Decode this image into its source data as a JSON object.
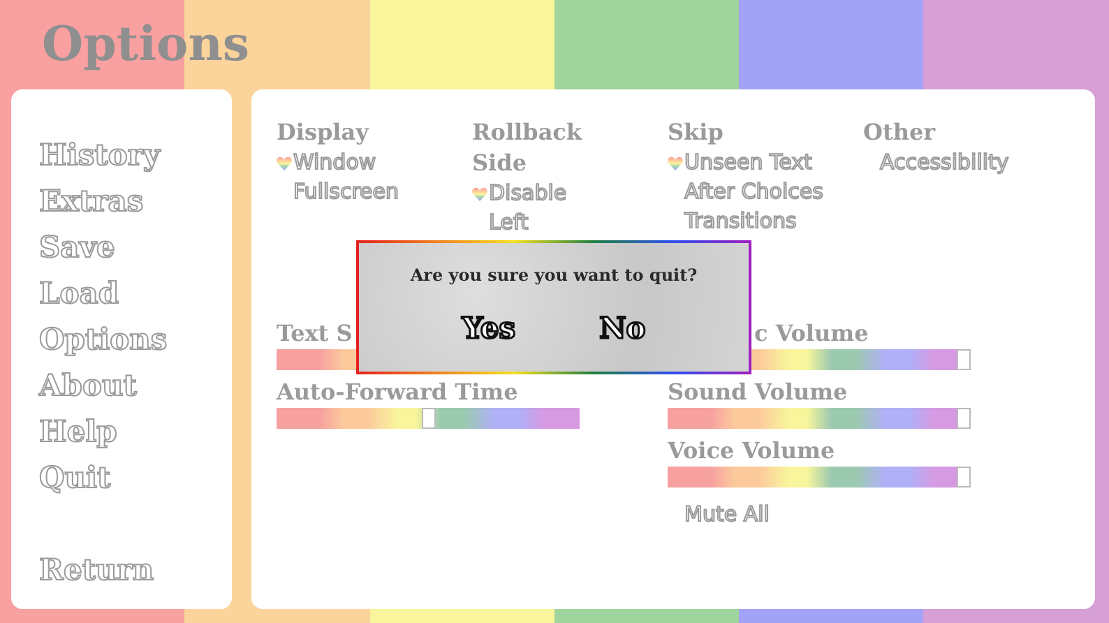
{
  "title": "Options",
  "menu": [
    {
      "label": "History"
    },
    {
      "label": "Extras"
    },
    {
      "label": "Save"
    },
    {
      "label": "Load"
    },
    {
      "label": "Options"
    },
    {
      "label": "About"
    },
    {
      "label": "Help"
    },
    {
      "label": "Quit"
    }
  ],
  "return_button": "Return",
  "groups": [
    {
      "title": "Display",
      "options": [
        {
          "label": "Window",
          "selected": true
        },
        {
          "label": "Fullscreen",
          "selected": false
        }
      ]
    },
    {
      "title": "Rollback Side",
      "options": [
        {
          "label": "Disable",
          "selected": true
        },
        {
          "label": "Left",
          "selected": false
        }
      ]
    },
    {
      "title": "Skip",
      "options": [
        {
          "label": "Unseen Text",
          "selected": true
        },
        {
          "label": "After Choices",
          "selected": false
        },
        {
          "label": "Transitions",
          "selected": false
        }
      ]
    },
    {
      "title": "Other",
      "options": [
        {
          "label": "Accessibility",
          "selected": false
        }
      ]
    }
  ],
  "left_sliders": [
    {
      "label": "Text S"
    },
    {
      "label": "Auto-Forward Time",
      "level": 0.5
    }
  ],
  "right_sliders": [
    {
      "label": "c Volume",
      "level": 1
    },
    {
      "label": "Sound Volume",
      "level": 1
    },
    {
      "label": "Voice Volume",
      "level": 1
    }
  ],
  "mute_all": "Mute All",
  "dialog": {
    "message": "Are you sure you want to quit?",
    "buttons": [
      "Yes",
      "No"
    ]
  }
}
